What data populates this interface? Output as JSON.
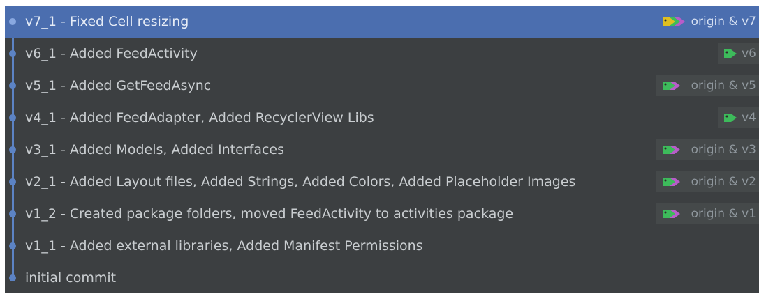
{
  "commits": [
    {
      "message": "v7_1 - Fixed Cell resizing",
      "ref": "origin & v7",
      "selected": true,
      "tag_kind": "multi",
      "tag_colors": [
        "#e0c020",
        "#3dbb5b",
        "#b85cc9"
      ]
    },
    {
      "message": "v6_1 - Added FeedActivity",
      "ref": "v6",
      "selected": false,
      "tag_kind": "single",
      "tag_colors": [
        "#3dbb5b"
      ]
    },
    {
      "message": "v5_1 - Added GetFeedAsync",
      "ref": "origin & v5",
      "selected": false,
      "tag_kind": "multi",
      "tag_colors": [
        "#3dbb5b",
        "#b85cc9"
      ]
    },
    {
      "message": "v4_1 - Added FeedAdapter, Added RecyclerView Libs",
      "ref": "v4",
      "selected": false,
      "tag_kind": "single",
      "tag_colors": [
        "#3dbb5b"
      ]
    },
    {
      "message": "v3_1 - Added Models, Added Interfaces",
      "ref": "origin & v3",
      "selected": false,
      "tag_kind": "multi",
      "tag_colors": [
        "#3dbb5b",
        "#b85cc9"
      ]
    },
    {
      "message": "v2_1 - Added Layout files, Added Strings, Added Colors, Added Placeholder Images",
      "ref": "origin & v2",
      "selected": false,
      "tag_kind": "multi",
      "tag_colors": [
        "#3dbb5b",
        "#b85cc9"
      ]
    },
    {
      "message": "v1_2 - Created package folders, moved FeedActivity to activities package",
      "ref": "origin & v1",
      "selected": false,
      "tag_kind": "multi",
      "tag_colors": [
        "#3dbb5b",
        "#b85cc9"
      ]
    },
    {
      "message": "v1_1 - Added external libraries, Added Manifest Permissions",
      "ref": "",
      "selected": false,
      "tag_kind": "none",
      "tag_colors": []
    },
    {
      "message": "initial commit",
      "ref": "",
      "selected": false,
      "tag_kind": "none",
      "tag_colors": []
    }
  ],
  "icons": {
    "tag": "tag-icon",
    "commit_node": "commit-node-icon"
  }
}
